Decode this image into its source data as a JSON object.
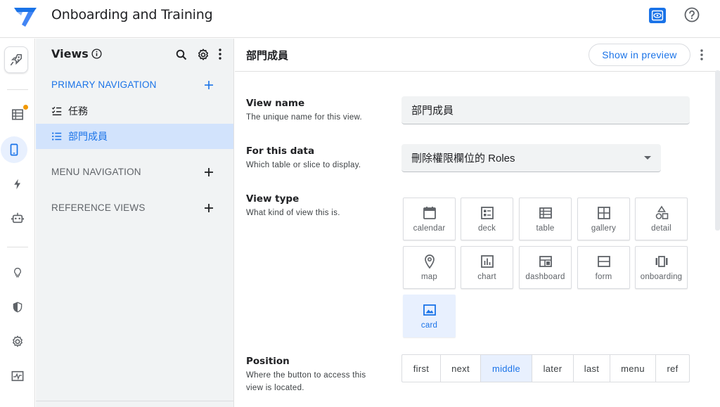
{
  "header": {
    "app_title": "Onboarding and Training",
    "icons": [
      "appsheet-logo-icon",
      "preview-eye-icon",
      "help-icon"
    ]
  },
  "rail": {
    "items": [
      {
        "name": "launch-icon"
      },
      {
        "name": "data-table-icon",
        "badge": true
      },
      {
        "name": "app-view-icon",
        "active": true
      },
      {
        "name": "automation-icon"
      },
      {
        "name": "bot-icon"
      },
      {
        "name": "lightbulb-icon"
      },
      {
        "name": "security-shield-icon"
      },
      {
        "name": "settings-gear-icon"
      },
      {
        "name": "monitor-icon"
      }
    ],
    "accent": "#f29900"
  },
  "views_panel": {
    "title": "Views",
    "primary_section": "PRIMARY NAVIGATION",
    "primary_items": [
      {
        "label": "任務",
        "selected": false
      },
      {
        "label": "部門成員",
        "selected": true
      }
    ],
    "menu_section": "MENU NAVIGATION",
    "reference_section": "REFERENCE VIEWS"
  },
  "main": {
    "title": "部門成員",
    "preview_button": "Show in preview",
    "view_name": {
      "label": "View name",
      "help": "The unique name for this view.",
      "value": "部門成員"
    },
    "for_this_data": {
      "label": "For this data",
      "help": "Which table or slice to display.",
      "value": "刪除權限欄位的 Roles"
    },
    "view_type": {
      "label": "View type",
      "help": "What kind of view this is.",
      "options": [
        {
          "label": "calendar",
          "icon": "calendar-icon"
        },
        {
          "label": "deck",
          "icon": "deck-icon"
        },
        {
          "label": "table",
          "icon": "table-icon"
        },
        {
          "label": "gallery",
          "icon": "gallery-icon"
        },
        {
          "label": "detail",
          "icon": "detail-shapes-icon"
        },
        {
          "label": "map",
          "icon": "map-pin-icon"
        },
        {
          "label": "chart",
          "icon": "chart-icon"
        },
        {
          "label": "dashboard",
          "icon": "dashboard-icon"
        },
        {
          "label": "form",
          "icon": "form-icon"
        },
        {
          "label": "onboarding",
          "icon": "onboarding-icon"
        },
        {
          "label": "card",
          "icon": "card-image-icon"
        }
      ],
      "selected": "card"
    },
    "position": {
      "label": "Position",
      "help": "Where the button to access this view is located.",
      "options": [
        "first",
        "next",
        "middle",
        "later",
        "last",
        "menu",
        "ref"
      ],
      "selected": "middle"
    }
  },
  "colors": {
    "primary": "#1a73e8",
    "selected_bg": "#e8f0fe",
    "panel_bg": "#f1f3f4",
    "nav_selected_bg": "#d2e3fc"
  }
}
